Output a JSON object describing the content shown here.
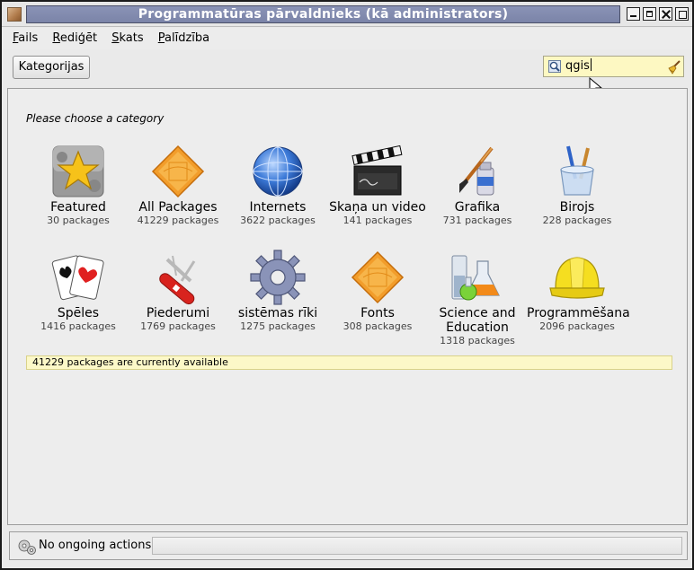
{
  "window": {
    "title": "Programmatūras pārvaldnieks (kā administrators)"
  },
  "menubar": {
    "items": [
      {
        "label": "Fails",
        "underline": "F"
      },
      {
        "label": "Rediģēt",
        "underline": "R"
      },
      {
        "label": "Skats",
        "underline": "S"
      },
      {
        "label": "Palīdzība",
        "underline": "P"
      }
    ]
  },
  "toolbar": {
    "categories_label": "Kategorijas",
    "search": {
      "value": "qgis",
      "icon": "magnifier-icon",
      "clear_icon": "broom-icon",
      "background": "#fdf8c2"
    }
  },
  "main": {
    "prompt": "Please choose a category",
    "categories": [
      {
        "name": "Featured",
        "count": "30 packages",
        "icon": "star-featured-icon"
      },
      {
        "name": "All Packages",
        "count": "41229 packages",
        "icon": "orange-package-icon"
      },
      {
        "name": "Internets",
        "count": "3622 packages",
        "icon": "globe-icon"
      },
      {
        "name": "Skaņa un video",
        "count": "141 packages",
        "icon": "clapperboard-icon"
      },
      {
        "name": "Grafika",
        "count": "731 packages",
        "icon": "paint-brush-icon"
      },
      {
        "name": "Birojs",
        "count": "228 packages",
        "icon": "pencil-cup-icon"
      },
      {
        "name": "Spēles",
        "count": "1416 packages",
        "icon": "playing-cards-icon"
      },
      {
        "name": "Piederumi",
        "count": "1769 packages",
        "icon": "swiss-knife-icon"
      },
      {
        "name": "sistēmas rīki",
        "count": "1275 packages",
        "icon": "gear-icon"
      },
      {
        "name": "Fonts",
        "count": "308 packages",
        "icon": "orange-package-icon"
      },
      {
        "name": "Science and Education",
        "count": "1318 packages",
        "icon": "lab-flask-icon"
      },
      {
        "name": "Programmēšana",
        "count": "2096 packages",
        "icon": "hard-hat-icon"
      }
    ],
    "availability": "41229 packages are currently available"
  },
  "statusbar": {
    "actions": "No ongoing actions",
    "icon": "gears-icon"
  },
  "colors": {
    "title_strip": "#7b84a8",
    "highlight_yellow": "#fcf8c8"
  }
}
